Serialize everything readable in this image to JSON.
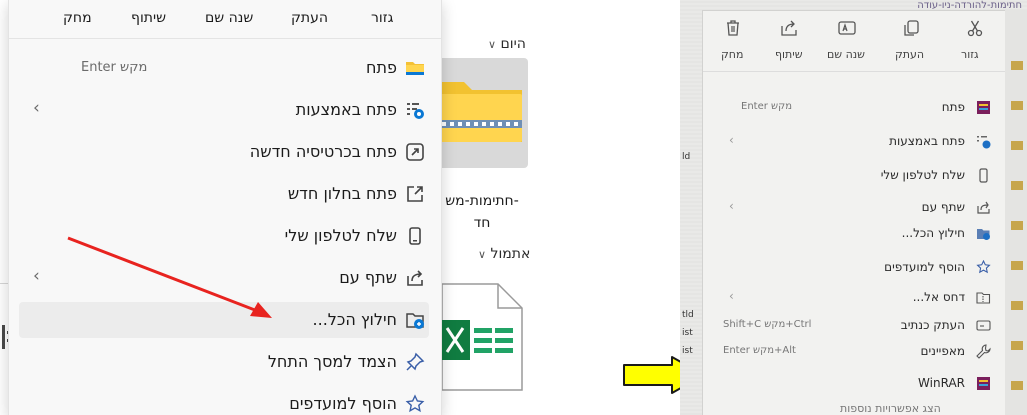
{
  "left": {
    "explorer": {
      "group_today": "היום",
      "group_yesterday": "אתמול",
      "zip_name_line1": "-חתימות-מש",
      "zip_name_line2": "חד"
    },
    "toolbar": {
      "cut": "גזור",
      "copy": "העתק",
      "rename": "שנה שם",
      "share": "שיתוף",
      "delete": "מחק"
    },
    "menu": [
      {
        "label": "פתח",
        "shortcut": "מקש Enter",
        "icon": "folder-icon",
        "submenu": false,
        "highlight": false
      },
      {
        "label": "פתח באמצעות",
        "shortcut": "",
        "icon": "open-with-icon",
        "submenu": true,
        "highlight": false
      },
      {
        "label": "פתח בכרטיסיה חדשה",
        "shortcut": "",
        "icon": "new-tab-icon",
        "submenu": false,
        "highlight": false
      },
      {
        "label": "פתח בחלון חדש",
        "shortcut": "",
        "icon": "new-window-icon",
        "submenu": false,
        "highlight": false
      },
      {
        "label": "שלח לטלפון שלי",
        "shortcut": "",
        "icon": "phone-icon",
        "submenu": false,
        "highlight": false
      },
      {
        "label": "שתף עם",
        "shortcut": "",
        "icon": "share-icon",
        "submenu": true,
        "highlight": false
      },
      {
        "label": "חילוץ הכל...",
        "shortcut": "",
        "icon": "extract-icon",
        "submenu": false,
        "highlight": true
      },
      {
        "label": "הצמד למסך התחל",
        "shortcut": "",
        "icon": "pin-icon",
        "submenu": false,
        "highlight": false
      },
      {
        "label": "הוסף למועדפים",
        "shortcut": "",
        "icon": "star-icon",
        "submenu": false,
        "highlight": false
      }
    ]
  },
  "right": {
    "title_partial": "חתימות-להורדה-ניו-עודה",
    "toolbar": {
      "cut": "גזור",
      "copy": "העתק",
      "rename": "שנה שם",
      "share": "שיתוף",
      "delete": "מחק"
    },
    "menu": [
      {
        "label": "פתח",
        "shortcut": "מקש Enter",
        "icon": "winrar-icon",
        "submenu": false
      },
      {
        "label": "פתח באמצעות",
        "shortcut": "",
        "icon": "open-with-icon",
        "submenu": true
      },
      {
        "label": "שלח לטלפון שלי",
        "shortcut": "",
        "icon": "phone-icon",
        "submenu": false
      },
      {
        "label": "שתף עם",
        "shortcut": "",
        "icon": "share-icon",
        "submenu": true
      },
      {
        "label": "חילוץ הכל...",
        "shortcut": "",
        "icon": "extract-icon",
        "submenu": false
      },
      {
        "label": "הוסף למועדפים",
        "shortcut": "",
        "icon": "star-icon",
        "submenu": false
      },
      {
        "label": "דחס אל...",
        "shortcut": "",
        "icon": "compress-icon",
        "submenu": true
      },
      {
        "label": "העתק כנתיב",
        "shortcut": "Ctrl+מקש Shift+C",
        "icon": "path-icon",
        "submenu": false
      },
      {
        "label": "מאפיינים",
        "shortcut": "Alt+מקש Enter",
        "icon": "wrench-icon",
        "submenu": false
      },
      {
        "label": "WinRAR",
        "shortcut": "",
        "icon": "winrar-icon",
        "submenu": true
      }
    ],
    "cut_bottom": "הצג אפשרויות נוספות",
    "left_labels": [
      "ld",
      "tld",
      "ist",
      "ist"
    ]
  },
  "colors": {
    "red_arrow": "#e8231f",
    "yellow_arrow_fill": "#ffff00",
    "yellow_arrow_stroke": "#1a1a1a",
    "highlight": "#ececec",
    "accent_blue": "#0067c0"
  }
}
